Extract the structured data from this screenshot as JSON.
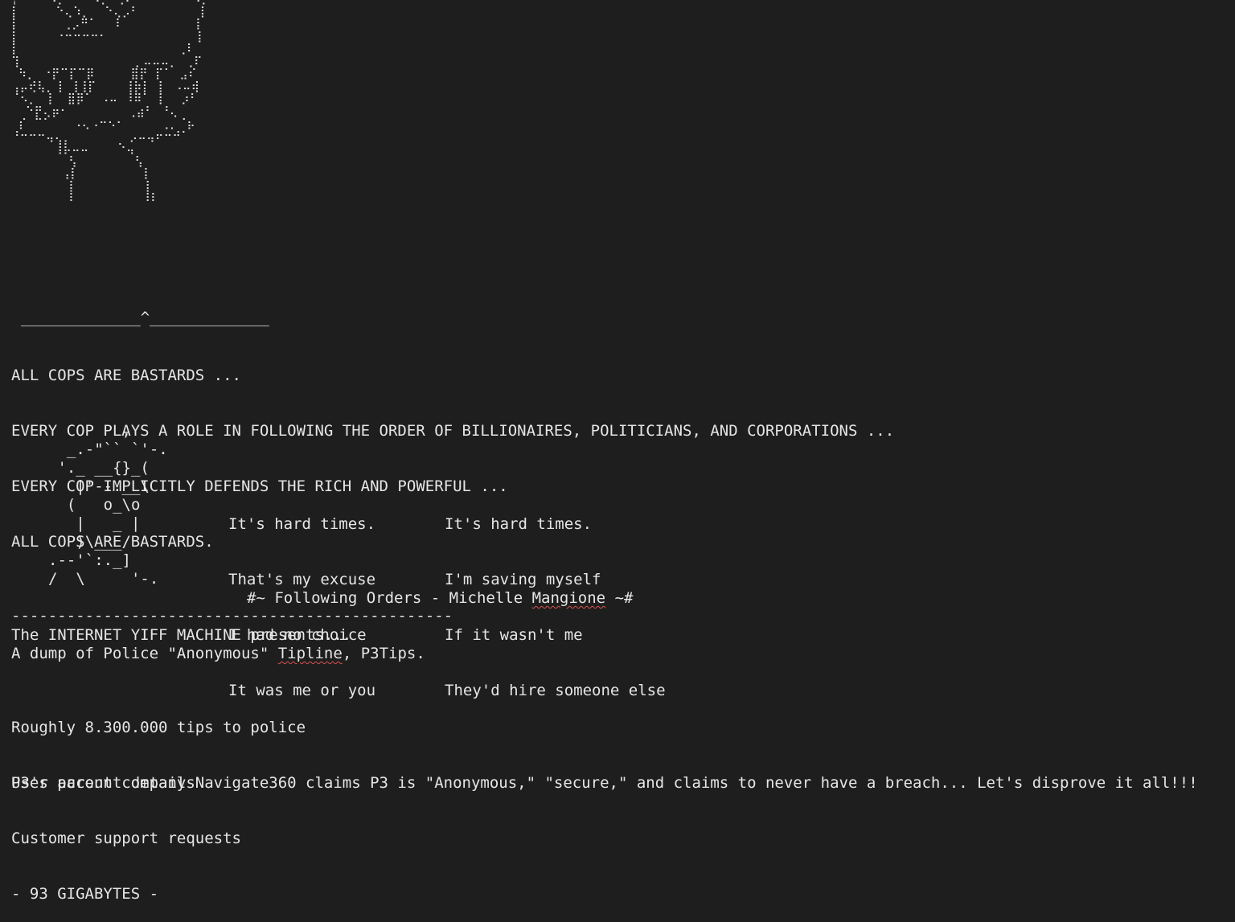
{
  "terminal": {
    "top_art": "┆   ⠈⠳⡀⠛⠉⠓⠢⡀ ⢀⠔⠁       ⠱⡀\n⡇     ⠑⢄⠱⡀  ⠑⢄⡠⠃        ⢸\n⡇      ⢀⡠⠛⠁  ⠸          ⢸\n⡇     ⠐⠒⠒⠒⠒⠂            ⢸\n⡇                      ⢀⠇\n⢹                ⡀⠤⠤⠤⡀ ⢀⠏\n ⠳⡀ ⠐⡟⠉⡏⠉⡿     ⣿⡟ ⡏⠁ ⣠⠎\n⢠⡤⢞⢧⡀⢸ ⢸⢸⡏    ⢸⡷⡇ ⡇ ⠠⠤⢾\n⠈⠢⡀ ⢸  ⣿⡿⠁ ⠠⠤ ⠸⠿⠁ ⡇  ⡰⠃\n  ⠑⡟⢄⡶⠂    ⠀   ⢀⣴⠃ ⠘⢄\n ⡎ ⠉⠁   ⠠⢄⠠⠒⠢⠂     ⢀⡀⠈⡦\n⠘⠒⠒⠒⢤⢄⡀        ⡠⠤⢤⠖⠒⠚⠁\n      ⢸⡧⠤⠤    ⠑⢤\n        ⢣        ⢣\n       ⢠⡇         ⡇\n        ⡇         ⢸\n        ⠇         ⠸⠇",
    "rule_short": "_____________^_____________",
    "manifesto": [
      "ALL COPS ARE BASTARDS ...",
      "EVERY COP PLAYS A ROLE IN FOLLOWING THE ORDER OF BILLIONAIRES, POLITICIANS, AND CORPORATIONS ...",
      "EVERY COP IMPLICITLY DEFENDS THE RICH AND POWERFUL ...",
      "ALL COPS ARE BASTARDS."
    ],
    "figure_art": "        ,\n  _.-\"`` `'-.\n '._ __{}_(\n   |'--.__\\\n  (   o_\\o\n   |   _ |\n   )\\___/\n.--'`:._]\n/  \\     '-.",
    "lyrics_left": [
      "It's hard times.",
      "That's my excuse",
      "I had no choice",
      "It was me or you"
    ],
    "lyrics_right": [
      "It's hard times.",
      "I'm saving myself",
      "If it wasn't me",
      "They'd hire someone else"
    ],
    "credit_prefix": "#~ Following Orders - Michelle ",
    "credit_name": "Mangione",
    "credit_suffix": " ~#",
    "rule_long": "------------------------------------------------",
    "presents": "The INTERNET YIFF MACHINE presents...",
    "dump_prefix": "A dump of Police \"Anonymous\" ",
    "dump_word": "Tipline",
    "dump_suffix": ", P3Tips.",
    "contents": [
      "Roughly 8.300.000 tips to police",
      "User account details",
      "Customer support requests",
      "- 93 GIGABYTES -"
    ],
    "claim": "P3's parent company Navigate360 claims P3 is \"Anonymous,\" \"secure,\" and claims to never have a breach... Let's disprove it all!!!"
  }
}
